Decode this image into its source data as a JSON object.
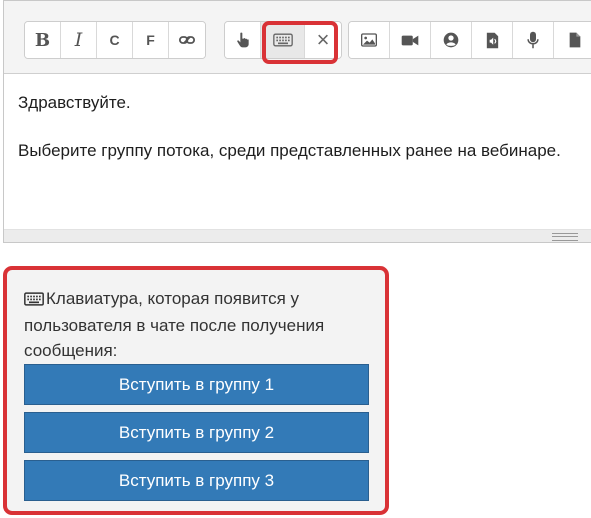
{
  "toolbar": {
    "format_group": [
      {
        "name": "bold-button",
        "label": "B"
      },
      {
        "name": "italic-button",
        "label": "I"
      },
      {
        "name": "c-button",
        "label": "C"
      },
      {
        "name": "f-button",
        "label": "F"
      },
      {
        "name": "link-button",
        "icon": "link-icon"
      }
    ],
    "keyboard_group": [
      {
        "name": "pointer-button",
        "icon": "hand-pointer-icon"
      },
      {
        "name": "keyboard-button",
        "icon": "keyboard-icon",
        "active": true
      },
      {
        "name": "remove-keyboard-button",
        "label": "×"
      }
    ],
    "media_group": [
      {
        "name": "image-button",
        "icon": "image-icon"
      },
      {
        "name": "video-button",
        "icon": "video-camera-icon"
      },
      {
        "name": "contact-button",
        "icon": "user-circle-icon"
      },
      {
        "name": "audio-file-button",
        "icon": "audio-file-icon"
      },
      {
        "name": "voice-button",
        "icon": "microphone-icon"
      },
      {
        "name": "document-button",
        "icon": "file-icon"
      }
    ]
  },
  "editor": {
    "paragraphs": [
      "Здравствуйте.",
      "Выберите группу потока, среди представленных ранее на вебинаре."
    ]
  },
  "keyboard_preview": {
    "caption": "Клавиатура, которая появится у пользователя в чате после получения сообщения:",
    "buttons": [
      "Вступить в группу 1",
      "Вступить в группу 2",
      "Вступить в группу 3"
    ]
  },
  "colors": {
    "highlight": "#d93236",
    "button_bg": "#337ab7",
    "panel_bg": "#f3f3f3",
    "toolbar_bg": "#f4f4f4"
  }
}
